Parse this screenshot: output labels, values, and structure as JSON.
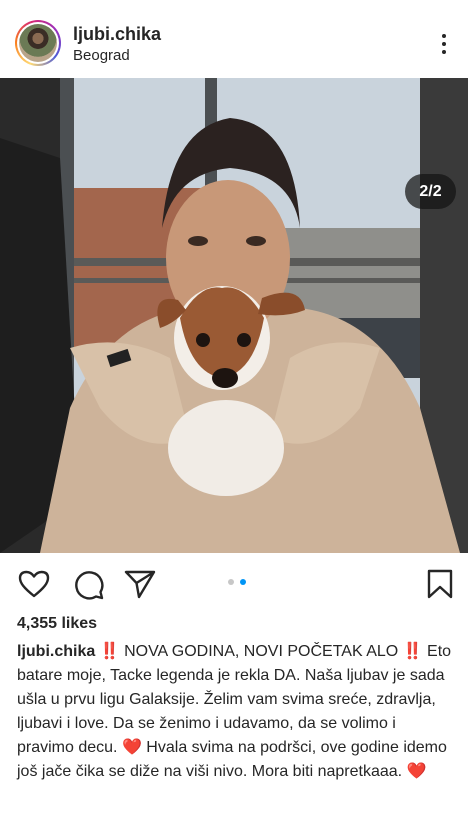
{
  "header": {
    "username": "ljubi.chika",
    "location": "Beograd"
  },
  "photo": {
    "counter": "2/2"
  },
  "carousel": {
    "total": 2,
    "active_index": 2
  },
  "post": {
    "likes": "4,355 likes",
    "caption_user": "ljubi.chika",
    "caption_line1": "‼️ NOVA GODINA, NOVI POČETAK ALO ‼️",
    "caption_body": "Eto batare moje, Tacke legenda je rekla DA. Naša ljubav je sada ušla u prvu ligu Galaksije. Želim vam svima sreće, zdravlja, ljubavi i love. Da se ženimo i udavamo, da se volimo i pravimo decu. ❤️ Hvala svima na podršci, ove godine idemo još jače čika se diže na viši nivo. Mora biti napretkaaa. ❤️"
  },
  "colors": {
    "text": "#262626",
    "active_dot": "#0095f6",
    "inactive_dot": "#c7c7c7",
    "heart_emoji": "#e0245e"
  },
  "icons": [
    "more-vertical-icon",
    "user-tag-icon",
    "heart-icon",
    "comment-icon",
    "share-icon",
    "bookmark-icon"
  ]
}
